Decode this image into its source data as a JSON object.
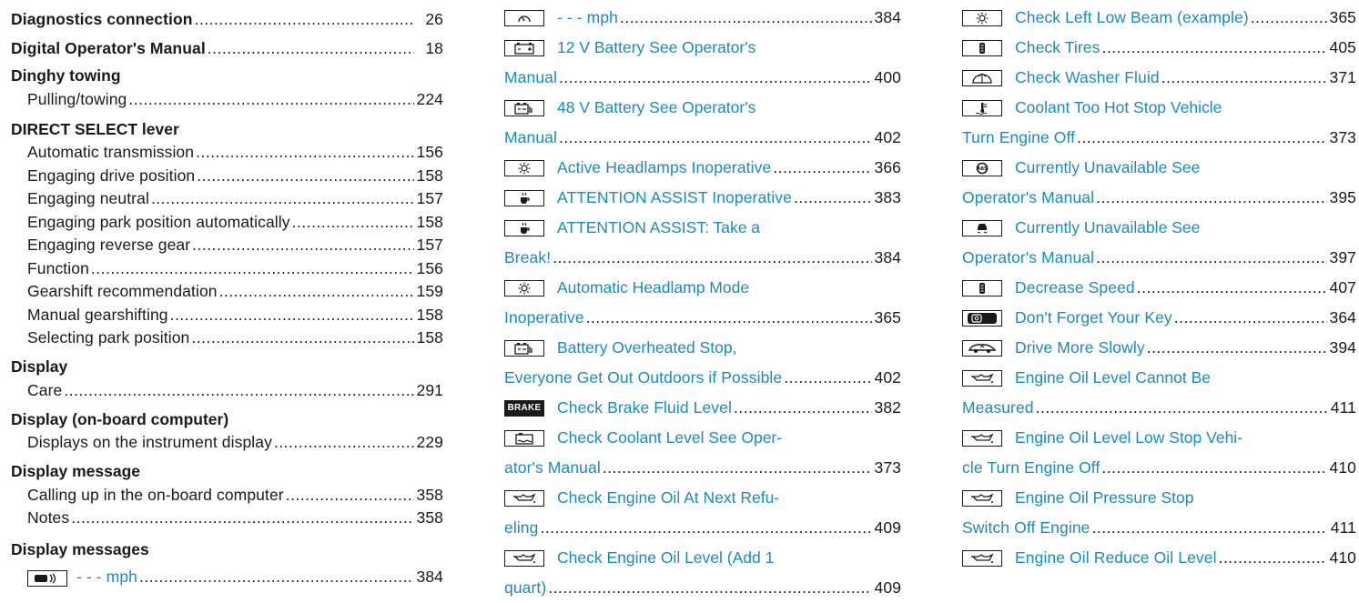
{
  "col1": {
    "diagnostics": {
      "label": "Diagnostics connection",
      "page": "26"
    },
    "digital_manual": {
      "label": "Digital Operator's Manual",
      "page": "18"
    },
    "dinghy": {
      "label": "Dinghy towing",
      "subs": [
        {
          "label": "Pulling/towing",
          "page": "224"
        }
      ]
    },
    "direct_select": {
      "label": "DIRECT SELECT lever",
      "subs": [
        {
          "label": "Automatic transmission",
          "page": "156"
        },
        {
          "label": "Engaging drive position",
          "page": "158"
        },
        {
          "label": "Engaging neutral",
          "page": "157"
        },
        {
          "label": "Engaging park position automatically",
          "page": "158"
        },
        {
          "label": "Engaging reverse gear",
          "page": "157"
        },
        {
          "label": "Function",
          "page": "156"
        },
        {
          "label": "Gearshift recommendation",
          "page": "159"
        },
        {
          "label": "Manual gearshifting",
          "page": "158"
        },
        {
          "label": "Selecting park position",
          "page": "158"
        }
      ]
    },
    "display": {
      "label": "Display",
      "subs": [
        {
          "label": "Care",
          "page": "291"
        }
      ]
    },
    "display_obc": {
      "label": "Display (on-board computer)",
      "subs": [
        {
          "label": "Displays on the instrument display",
          "page": "229"
        }
      ]
    },
    "display_message": {
      "label": "Display message",
      "subs": [
        {
          "label": "Calling up in the on-board computer",
          "page": "358"
        },
        {
          "label": "Notes",
          "page": "358"
        }
      ]
    },
    "display_messages": {
      "label": "Display messages",
      "first": {
        "icon": "distance-warning-icon",
        "label": "- - - mph",
        "page": "384"
      }
    }
  },
  "col2": [
    {
      "icon": "speed-limiter-icon",
      "lines": [
        "- - - mph"
      ],
      "page": "384"
    },
    {
      "icon": "battery-12v-icon",
      "lines": [
        "12 V Battery See Operator's",
        "Manual"
      ],
      "page": "400"
    },
    {
      "icon": "battery-48v-icon",
      "lines": [
        "48 V Battery See Operator's",
        "Manual"
      ],
      "page": "402"
    },
    {
      "icon": "headlamp-icon",
      "lines": [
        "Active Headlamps Inoperative"
      ],
      "page": "366"
    },
    {
      "icon": "coffee-cup-icon",
      "lines": [
        "ATTENTION ASSIST Inoperative"
      ],
      "page": "383"
    },
    {
      "icon": "coffee-cup-icon",
      "lines": [
        "ATTENTION ASSIST: Take a",
        "Break!"
      ],
      "page": "384"
    },
    {
      "icon": "headlamp-icon",
      "lines": [
        "Automatic Headlamp Mode",
        "Inoperative"
      ],
      "page": "365"
    },
    {
      "icon": "battery-48v-icon",
      "lines": [
        "Battery Overheated Stop,",
        "Everyone Get Out Outdoors if Possible"
      ],
      "page": "402"
    },
    {
      "icon": "brake-icon",
      "icon_text": "BRAKE",
      "lines": [
        "Check Brake Fluid Level"
      ],
      "page": "382"
    },
    {
      "icon": "coolant-level-icon",
      "lines": [
        "Check Coolant Level See Oper-",
        "ator's Manual"
      ],
      "page": "373"
    },
    {
      "icon": "oil-can-icon",
      "lines": [
        "Check Engine Oil At Next Refu-",
        "eling"
      ],
      "page": "409"
    },
    {
      "icon": "oil-can-icon",
      "lines": [
        "Check Engine Oil Level (Add 1",
        "quart)"
      ],
      "page": "409"
    }
  ],
  "col3": [
    {
      "icon": "headlamp-icon",
      "lines": [
        "Check Left Low Beam (example)"
      ],
      "page": "365"
    },
    {
      "icon": "tire-icon",
      "lines": [
        "Check Tires"
      ],
      "page": "405"
    },
    {
      "icon": "washer-fluid-icon",
      "lines": [
        "Check Washer Fluid"
      ],
      "page": "371"
    },
    {
      "icon": "coolant-temp-icon",
      "lines": [
        "Coolant Too Hot Stop Vehicle",
        "Turn Engine Off"
      ],
      "page": "373"
    },
    {
      "icon": "abs-icon",
      "lines": [
        "Currently Unavailable See",
        "Operator's Manual"
      ],
      "page": "395"
    },
    {
      "icon": "esp-icon",
      "lines": [
        "Currently Unavailable See",
        "Operator's Manual"
      ],
      "page": "397"
    },
    {
      "icon": "tire-icon",
      "lines": [
        "Decrease Speed"
      ],
      "page": "407"
    },
    {
      "icon": "key-icon",
      "lines": [
        "Don't Forget Your Key"
      ],
      "page": "364"
    },
    {
      "icon": "car-lowered-icon",
      "lines": [
        "Drive More Slowly"
      ],
      "page": "394"
    },
    {
      "icon": "oil-can-icon",
      "lines": [
        "Engine Oil Level Cannot Be",
        "Measured"
      ],
      "page": "411"
    },
    {
      "icon": "oil-can-icon",
      "lines": [
        "Engine Oil Level Low Stop Vehi-",
        "cle Turn Engine Off"
      ],
      "page": "410"
    },
    {
      "icon": "oil-can-icon",
      "lines": [
        "Engine Oil Pressure Stop",
        "Switch Off Engine"
      ],
      "page": "411"
    },
    {
      "icon": "oil-can-icon",
      "lines": [
        "Engine Oil Reduce Oil Level"
      ],
      "page": "410"
    }
  ],
  "colors": {
    "link": "#1a8bbd",
    "text": "#1a1a1a"
  }
}
